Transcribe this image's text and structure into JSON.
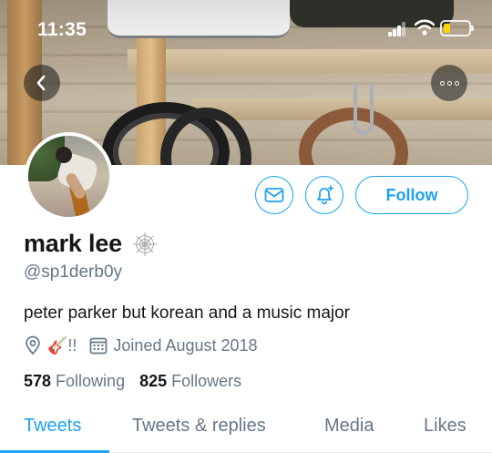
{
  "status_bar": {
    "time": "11:35",
    "battery_level": 0.25,
    "battery_color": "#ffd60a"
  },
  "nav": {
    "back_icon": "chevron-left-icon",
    "more_icon": "more-horizontal-icon"
  },
  "actions": {
    "message_icon": "mail-icon",
    "notify_icon": "bell-plus-icon",
    "follow_label": "Follow",
    "accent_color": "#1da1f2"
  },
  "profile": {
    "display_name": "mark lee",
    "name_badge_icon": "spider-web-icon",
    "handle": "@sp1derb0y",
    "bio": "peter parker but korean and a music major",
    "location_icon": "location-pin-icon",
    "location_text": "🎸!!",
    "calendar_icon": "calendar-icon",
    "joined": "Joined August 2018",
    "following_count": "578",
    "following_label": "Following",
    "followers_count": "825",
    "followers_label": "Followers"
  },
  "tabs": [
    {
      "label": "Tweets",
      "active": true
    },
    {
      "label": "Tweets & replies",
      "active": false
    },
    {
      "label": "Media",
      "active": false
    },
    {
      "label": "Likes",
      "active": false
    }
  ]
}
